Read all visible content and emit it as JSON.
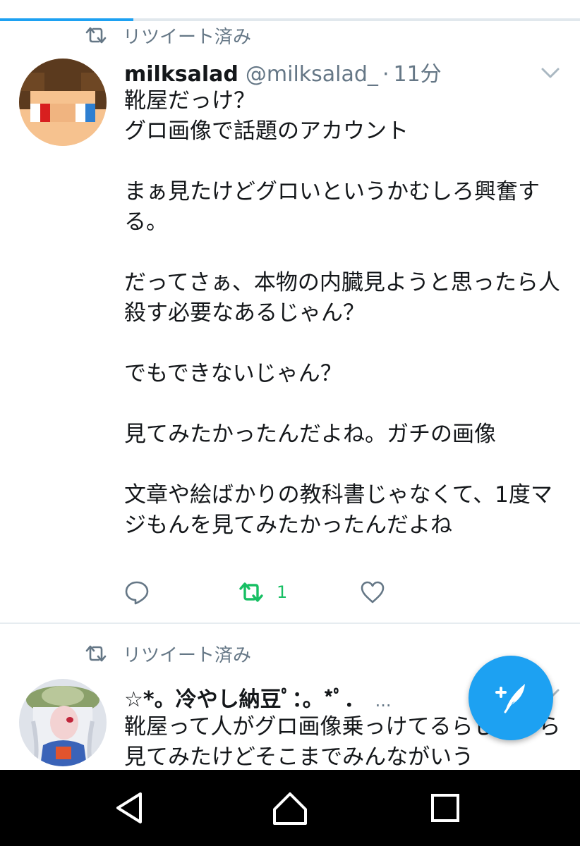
{
  "progress": {
    "fraction": 0.23,
    "color": "#1da1f2"
  },
  "tweets": [
    {
      "retweet_label": "リツイート済み",
      "name": "milksalad",
      "handle": "@milksalad_",
      "separator": "·",
      "time": "11分",
      "text": "靴屋だっけ？\nグロ画像で話題のアカウント\n\nまぁ見たけどグロいというかむしろ興奮する。\n\nだってさぁ、本物の内臓見ようと思ったら人殺す必要なあるじゃん？\n\nでもできないじゃん？\n\n見てみたかったんだよね。ガチの画像\n\n文章や絵ばかりの教科書じゃなくて、1度マジもんを見てみたかったんだよね",
      "retweet_count": "1",
      "icons": [
        "retweet-icon",
        "avatar-pixel",
        "chevron-down-icon",
        "reply-icon",
        "retweet-icon",
        "like-icon"
      ]
    },
    {
      "retweet_label": "リツイート済み",
      "name": "☆*。冷やし納豆ﾟ：。*ﾟ．",
      "ellipsis": "...",
      "text": "靴屋って人がグロ画像乗っけてるらしいから見てみたけどそこまでみんながいう",
      "icons": [
        "retweet-icon",
        "avatar-anime",
        "chevron-down-icon"
      ]
    }
  ],
  "fab": {
    "icon": "compose-tweet-icon"
  },
  "navbar": {
    "icons": [
      "back-icon",
      "home-icon",
      "recent-apps-icon"
    ]
  },
  "colors": {
    "accent": "#1da1f2",
    "retweet_green": "#17bf63",
    "muted": "#657786",
    "text": "#14171a"
  }
}
